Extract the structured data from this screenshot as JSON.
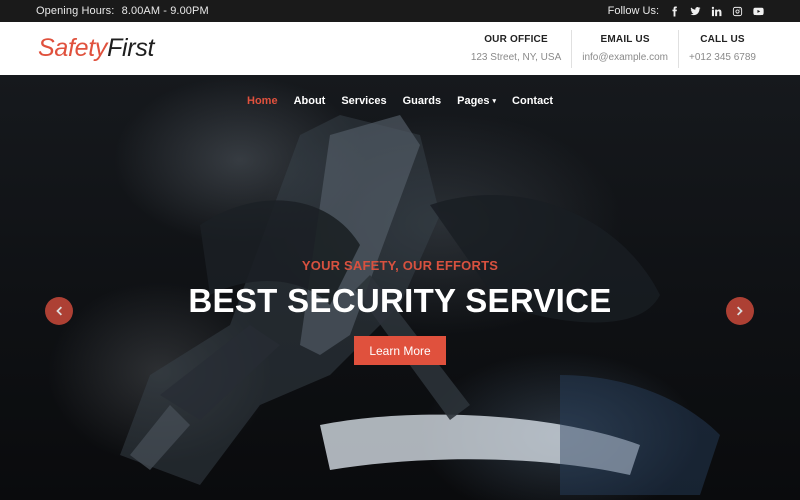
{
  "topbar": {
    "hours_label": "Opening Hours:",
    "hours_value": "8.00AM - 9.00PM",
    "follow_label": "Follow Us:",
    "social_icons": [
      "facebook-icon",
      "twitter-icon",
      "linkedin-icon",
      "instagram-icon",
      "youtube-icon"
    ]
  },
  "header": {
    "logo_part1": "Safety",
    "logo_part2": "First",
    "contacts": [
      {
        "title": "OUR OFFICE",
        "value": "123 Street, NY, USA"
      },
      {
        "title": "EMAIL US",
        "value": "info@example.com"
      },
      {
        "title": "CALL US",
        "value": "+012 345 6789"
      }
    ]
  },
  "nav": {
    "items": [
      {
        "label": "Home",
        "active": true
      },
      {
        "label": "About"
      },
      {
        "label": "Services"
      },
      {
        "label": "Guards"
      },
      {
        "label": "Pages",
        "dropdown": true
      },
      {
        "label": "Contact"
      }
    ],
    "caret": "▾"
  },
  "hero": {
    "tagline": "YOUR SAFETY, OUR EFFORTS",
    "headline": "BEST SECURITY SERVICE",
    "button": "Learn More"
  },
  "colors": {
    "accent": "#e0513d",
    "topbar_bg": "#1a1a1a",
    "header_bg": "#ffffff",
    "hero_bg": "#0e1013"
  }
}
